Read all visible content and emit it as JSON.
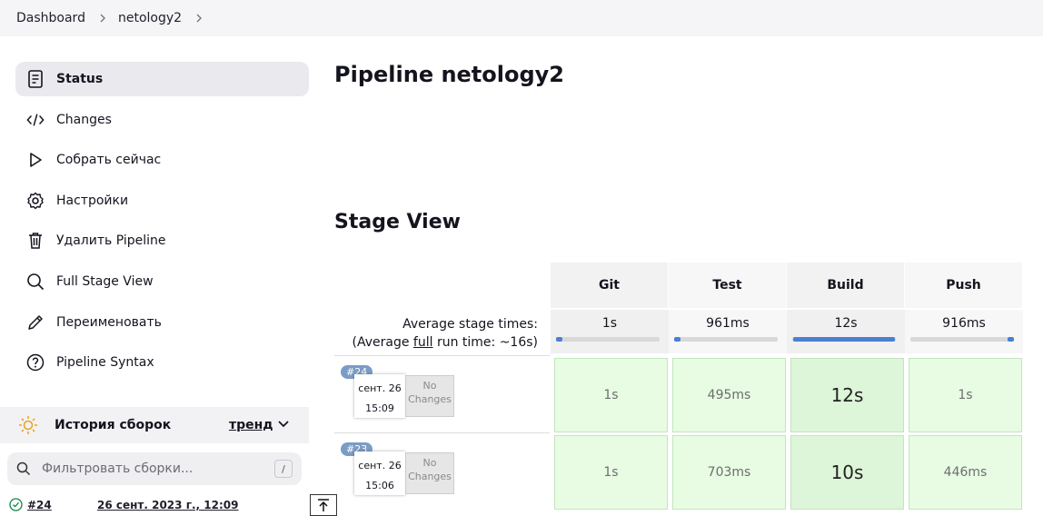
{
  "breadcrumb": [
    "Dashboard",
    "netology2"
  ],
  "sidebar": {
    "items": [
      {
        "label": "Status",
        "icon": "document-icon"
      },
      {
        "label": "Changes",
        "icon": "code-icon"
      },
      {
        "label": "Собрать сейчас",
        "icon": "play-icon"
      },
      {
        "label": "Настройки",
        "icon": "gear-icon"
      },
      {
        "label": "Удалить Pipeline",
        "icon": "trash-icon"
      },
      {
        "label": "Full Stage View",
        "icon": "search-icon"
      },
      {
        "label": "Переименовать",
        "icon": "pencil-icon"
      },
      {
        "label": "Pipeline Syntax",
        "icon": "help-icon"
      }
    ],
    "history": {
      "title": "История сборок",
      "trend": "тренд"
    },
    "filter": {
      "placeholder": "Фильтровать сборки...",
      "shortcut": "/"
    },
    "builds": [
      {
        "number": "#24",
        "date": "26 сент. 2023 г., 12:09"
      }
    ]
  },
  "main": {
    "title": "Pipeline netology2",
    "stage_view_title": "Stage View",
    "stages": [
      "Git",
      "Test",
      "Build",
      "Push"
    ],
    "avg_label_line1": "Average stage times:",
    "avg_label_line2_pre": "(Average ",
    "avg_label_full": "full",
    "avg_label_line2_post": " run time: ~16s)",
    "avg_times": [
      "1s",
      "961ms",
      "12s",
      "916ms"
    ],
    "avg_fractions": [
      0.06,
      0.06,
      0.98,
      0.06
    ],
    "runs": [
      {
        "badge": "#24",
        "date": "сент. 26",
        "time": "15:09",
        "changes_line1": "No",
        "changes_line2": "Changes",
        "stages": [
          "1s",
          "495ms",
          "12s",
          "1s"
        ]
      },
      {
        "badge": "#23",
        "date": "сент. 26",
        "time": "15:06",
        "changes_line1": "No",
        "changes_line2": "Changes",
        "stages": [
          "1s",
          "703ms",
          "10s",
          "446ms"
        ]
      }
    ]
  },
  "colors": {
    "success_cell": "#e7fce3",
    "bar_fill": "#4a7fd4",
    "badge": "#7a9cc6"
  }
}
